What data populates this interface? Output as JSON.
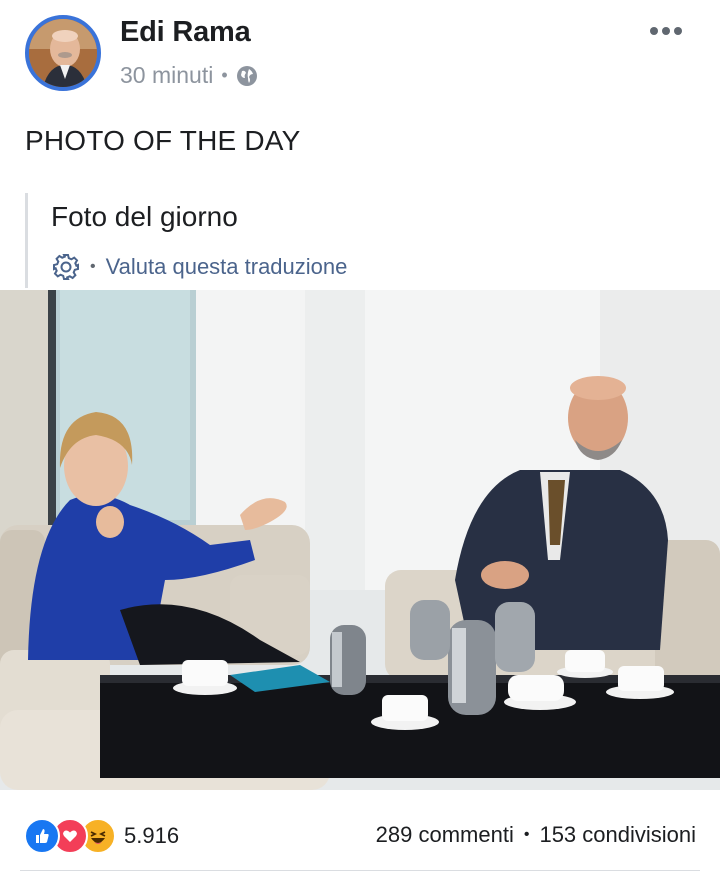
{
  "post": {
    "author": "Edi Rama",
    "time": "30 minuti",
    "privacy_icon": "globe-icon",
    "text": "PHOTO OF THE DAY",
    "translation": {
      "text": "Foto del giorno",
      "rate_label": "Valuta questa traduzione",
      "icon": "gear-icon"
    },
    "photo": {
      "icon": "photo-image"
    }
  },
  "footer": {
    "reaction_icons": [
      "like-icon",
      "love-icon",
      "haha-icon"
    ],
    "reaction_count": "5.916",
    "comments": "289 commenti",
    "shares": "153 condivisioni"
  },
  "colors": {
    "accent": "#1877f2",
    "link": "#4b648c",
    "muted": "#8d949e",
    "love": "#f33e58",
    "haha": "#f7b125"
  }
}
